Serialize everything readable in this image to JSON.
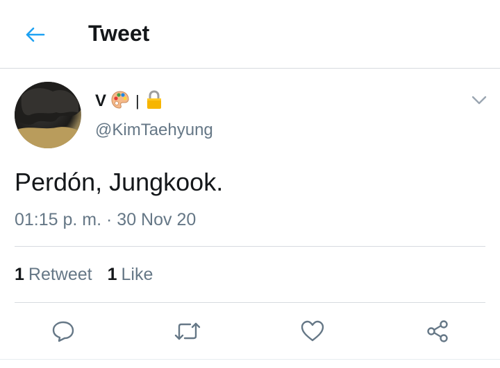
{
  "header": {
    "title": "Tweet",
    "back_icon": "arrow-left-icon"
  },
  "colors": {
    "accent": "#1da1f2",
    "text_primary": "#14171a",
    "text_secondary": "#657786",
    "divider": "#d6dadf"
  },
  "tweet": {
    "display_name": "V",
    "name_separator": "|",
    "name_emojis": [
      "artist-palette-emoji",
      "lock-emoji"
    ],
    "handle": "@KimTaehyung",
    "text": "Perdón, Jungkook.",
    "timestamp": "01:15 p. m. · 30 Nov 20"
  },
  "stats": {
    "retweets_count": "1",
    "retweets_label": "Retweet",
    "likes_count": "1",
    "likes_label": "Like"
  },
  "actions": [
    "reply-icon",
    "retweet-icon",
    "like-icon",
    "share-icon"
  ]
}
